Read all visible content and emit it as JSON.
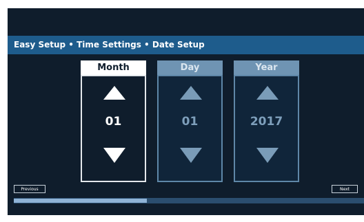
{
  "title": "Easy Setup • Time Settings • Date Setup",
  "spinners": {
    "month": {
      "label": "Month",
      "value": "01",
      "active": true
    },
    "day": {
      "label": "Day",
      "value": "01",
      "active": false
    },
    "year": {
      "label": "Year",
      "value": "2017",
      "active": false
    }
  },
  "buttons": {
    "previous": "Previous",
    "next": "Next"
  },
  "progress": {
    "fraction": 0.38
  },
  "icons": {
    "increment": "triangle-up-icon",
    "decrement": "triangle-down-icon"
  },
  "colors": {
    "background": "#0f1d2c",
    "titlebar": "#1e5c8c",
    "active_header": "#ffffff",
    "inactive_header": "#6f94b3",
    "progress_fill": "#8fb3d6",
    "progress_track": "#2b4e6f"
  }
}
